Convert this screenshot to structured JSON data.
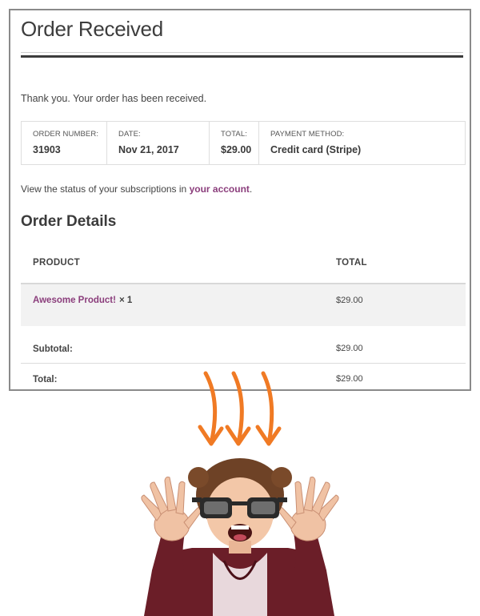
{
  "page": {
    "title": "Order Received",
    "thank_you": "Thank you. Your order has been received."
  },
  "overview": [
    {
      "label": "ORDER NUMBER:",
      "value": "31903"
    },
    {
      "label": "DATE:",
      "value": "Nov 21, 2017"
    },
    {
      "label": "TOTAL:",
      "value": "$29.00"
    },
    {
      "label": "PAYMENT METHOD:",
      "value": "Credit card (Stripe)"
    }
  ],
  "subscription_note": {
    "prefix": "View the status of your subscriptions in ",
    "link": "your account",
    "suffix": "."
  },
  "order_details": {
    "heading": "Order Details",
    "columns": [
      "PRODUCT",
      "TOTAL"
    ],
    "items": [
      {
        "name": "Awesome Product!",
        "qty": "× 1",
        "total": "$29.00"
      }
    ],
    "subtotal_label": "Subtotal:",
    "subtotal_value": "$29.00",
    "total_label": "Total:",
    "total_value": "$29.00"
  },
  "colors": {
    "link": "#8b3e7c",
    "arrow": "#f07a24",
    "frame": "#8a8a8a"
  },
  "illustration": {
    "arrows": 3,
    "subject": "shocked-girl-with-glasses"
  }
}
